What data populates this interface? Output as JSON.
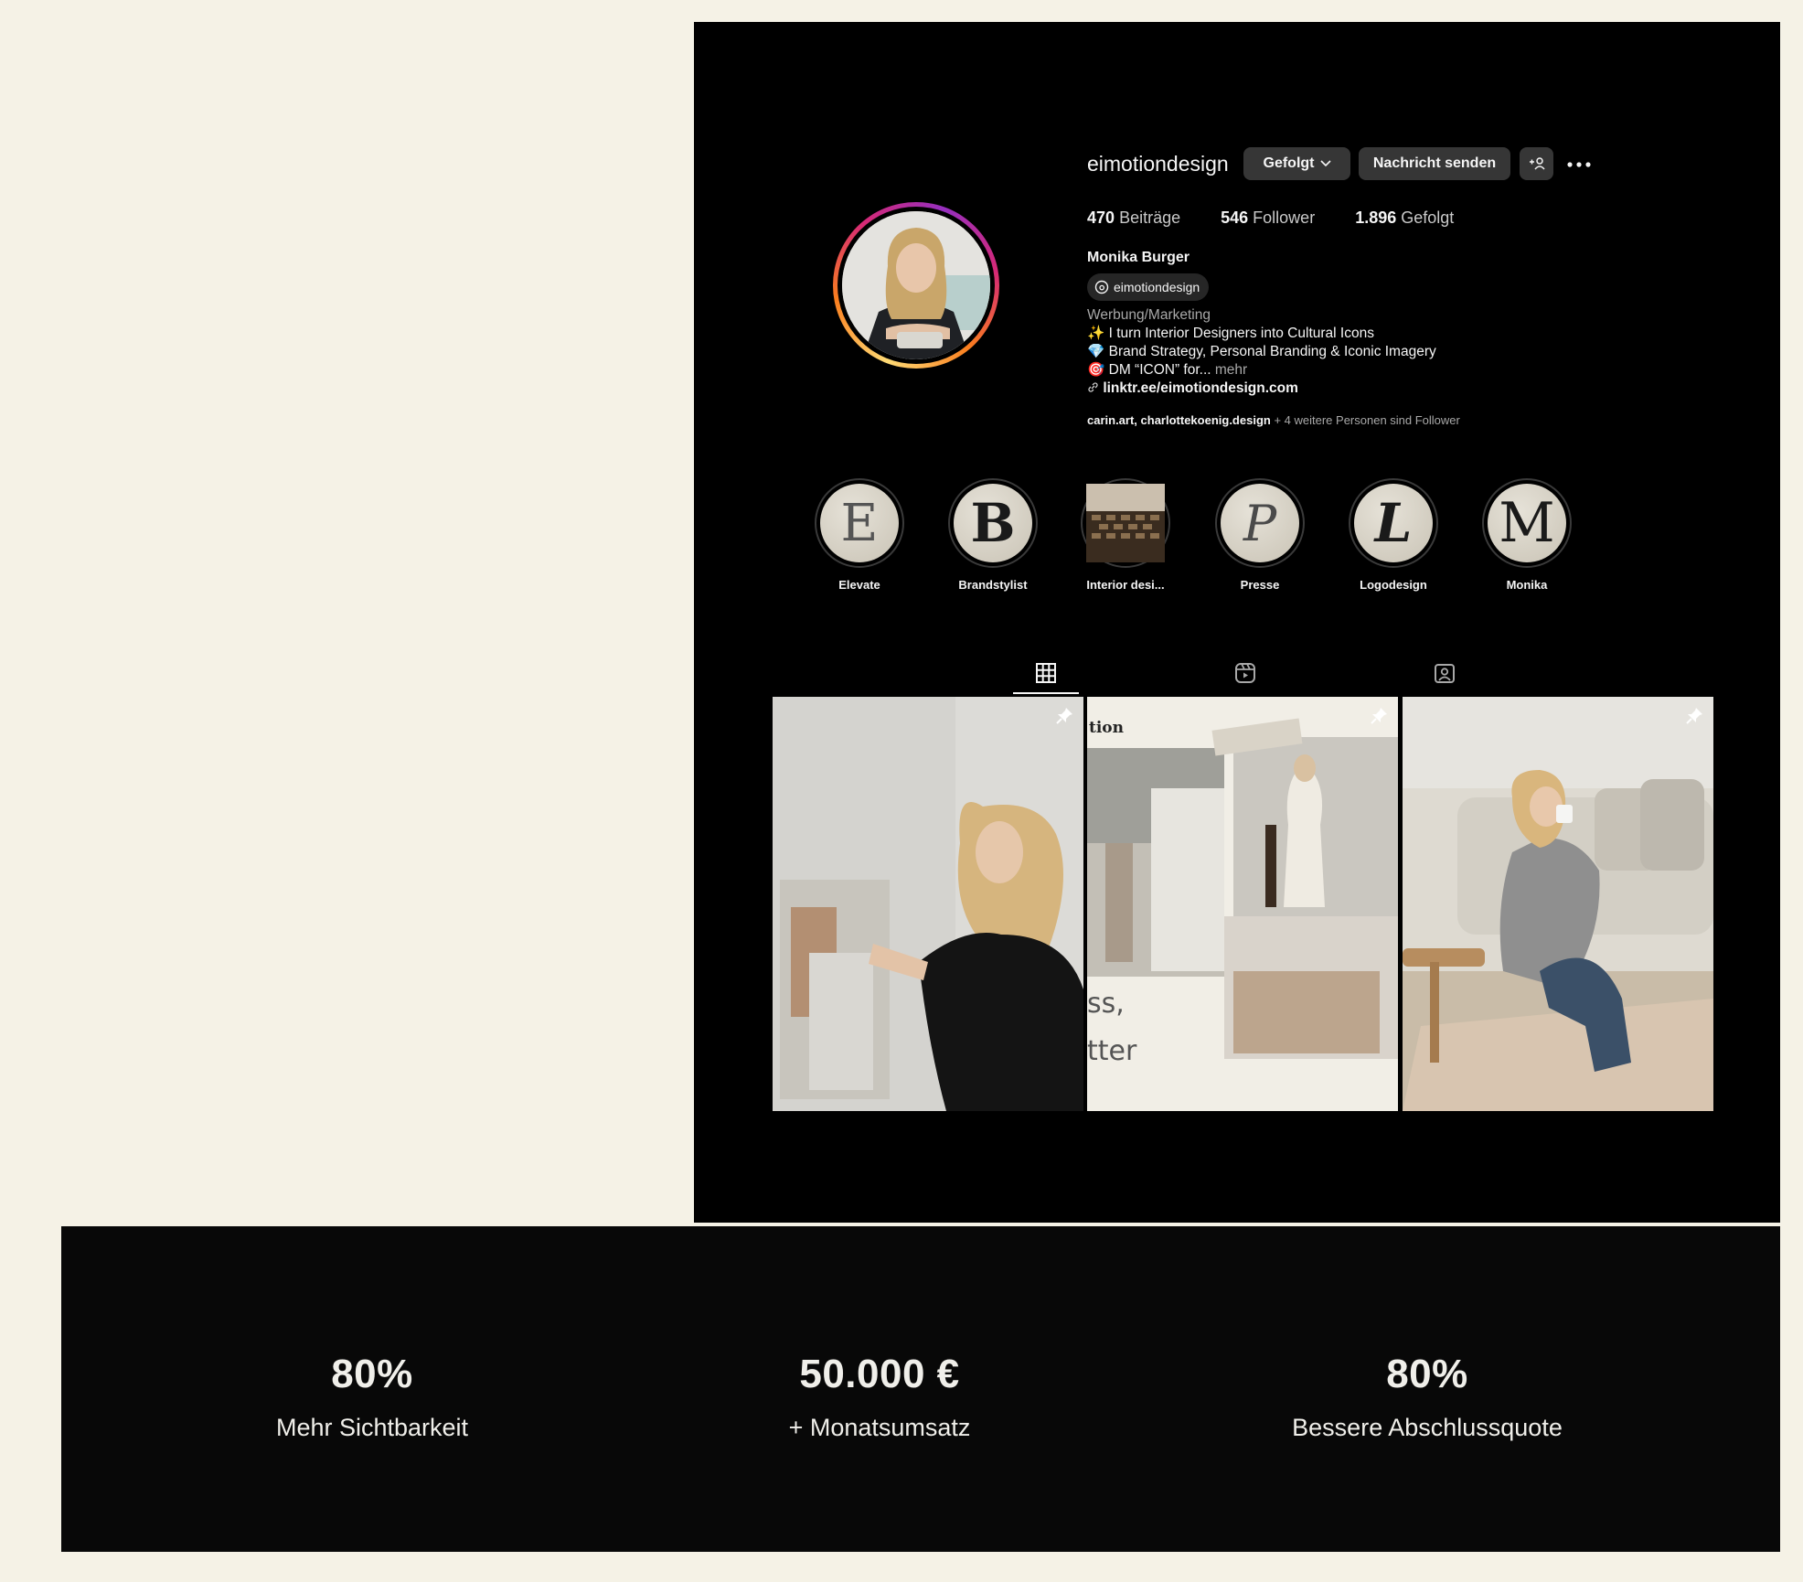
{
  "profile": {
    "username": "eimotiondesign",
    "follow_button": "Gefolgt",
    "message_button": "Nachricht senden",
    "stats": {
      "posts_count": "470",
      "posts_label": "Beiträge",
      "followers_count": "546",
      "followers_label": "Follower",
      "following_count": "1.896",
      "following_label": "Gefolgt"
    },
    "full_name": "Monika Burger",
    "threads_handle": "eimotiondesign",
    "category": "Werbung/Marketing",
    "bio_lines": [
      {
        "emoji": "✨",
        "text": "I turn Interior Designers into Cultural Icons"
      },
      {
        "emoji": "💎",
        "text": "Brand Strategy, Personal Branding & Iconic Imagery"
      },
      {
        "emoji": "🎯",
        "text": "DM “ICON” for...",
        "more": "mehr"
      }
    ],
    "link": "linktr.ee/eimotiondesign.com",
    "followed_by_names": "carin.art, charlottekoenig.design",
    "followed_by_rest": "+ 4 weitere Personen sind Follower"
  },
  "highlights": [
    {
      "label": "Elevate",
      "letter": "E"
    },
    {
      "label": "Brandstylist",
      "letter": "B"
    },
    {
      "label": "Interior desi...",
      "letter": ""
    },
    {
      "label": "Presse",
      "letter": "P"
    },
    {
      "label": "Logodesign",
      "letter": "L"
    },
    {
      "label": "Monika",
      "letter": "M"
    }
  ],
  "posts": {
    "post2_text_top": "tion",
    "post2_text_mid": "ss,",
    "post2_text_bottom": "tter"
  },
  "metrics": [
    {
      "value": "80%",
      "caption": "Mehr Sichtbarkeit"
    },
    {
      "value": "50.000 €",
      "caption": "+ Monatsumsatz"
    },
    {
      "value": "80%",
      "caption": "Bessere Abschlussquote"
    }
  ]
}
